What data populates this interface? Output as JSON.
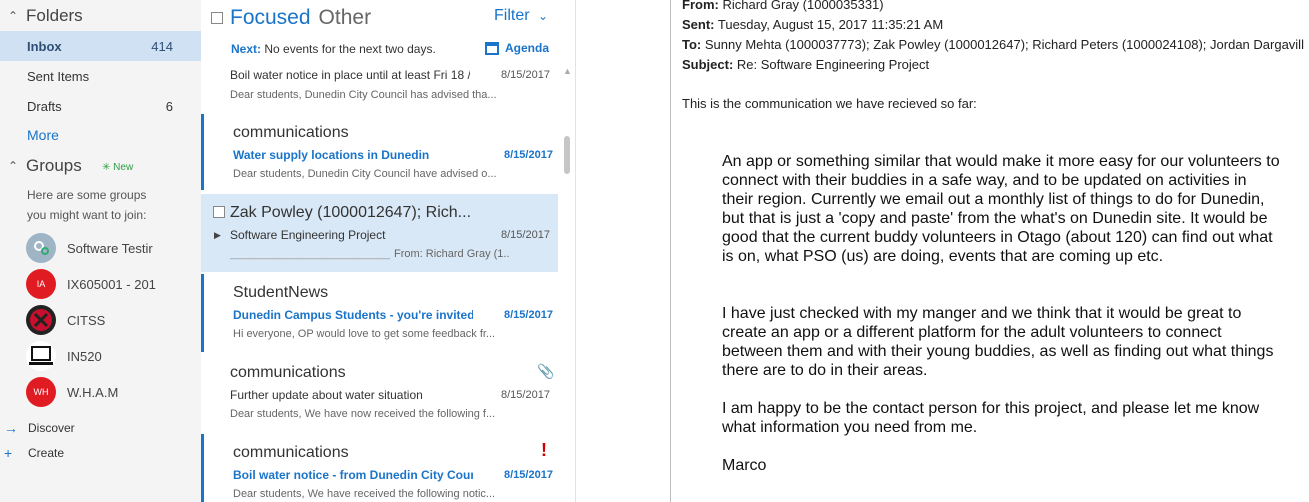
{
  "folders_pane": {
    "folders_title": "Folders",
    "items": [
      {
        "name": "Inbox",
        "count": "414"
      },
      {
        "name": "Sent Items",
        "count": ""
      },
      {
        "name": "Drafts",
        "count": "6"
      }
    ],
    "more_label": "More",
    "groups_title": "Groups",
    "new_badge": "New",
    "hint_line1": "Here are some groups",
    "hint_line2": "you might want to join:",
    "groups": [
      {
        "name": "Software Testir",
        "avatar_text": "",
        "color": "#9fb4c4"
      },
      {
        "name": "IX605001 - 201",
        "avatar_text": "IA",
        "color": "#e01b22"
      },
      {
        "name": "CITSS",
        "avatar_text": "",
        "color": "#c8102e"
      },
      {
        "name": "IN520",
        "avatar_text": "",
        "color": "#ffffff"
      },
      {
        "name": "W.H.A.M",
        "avatar_text": "WH",
        "color": "#e01b22"
      }
    ],
    "discover_label": "Discover",
    "create_label": "Create"
  },
  "message_list": {
    "tab_focused": "Focused",
    "tab_other": "Other",
    "filter_label": "Filter",
    "next_label": "Next:",
    "next_text": "No events for the next two days.",
    "agenda_label": "Agenda",
    "messages": [
      {
        "sender": "",
        "subject": "Boil water notice in place until at least Fri 18 /",
        "date": "8/15/2017",
        "preview": "Dear students,   Dunedin City Council has advised tha..."
      },
      {
        "sender": "communications",
        "subject": "Water supply locations in Dunedin",
        "date": "8/15/2017",
        "preview": "Dear students,   Dunedin City Council have advised o..."
      },
      {
        "sender": "Zak Powley (1000012647); Rich...",
        "subject": "Software Engineering Project",
        "date": "8/15/2017",
        "preview": "_________________________________  From: Richard Gray (1...",
        "preview_left": "_______________________________",
        "preview_right": "From: Richard Gray (1..."
      },
      {
        "sender": "StudentNews",
        "subject": "Dunedin Campus Students - you're invited t",
        "date": "8/15/2017",
        "preview": "Hi everyone,  OP would love to get some feedback fr..."
      },
      {
        "sender": "communications",
        "subject": "Further update about water situation",
        "date": "8/15/2017",
        "preview": "Dear students,   We have now received the following f..."
      },
      {
        "sender": "communications",
        "subject": "Boil water notice - from Dunedin City Counc",
        "date": "8/15/2017",
        "preview": "Dear students,   We have received the following notic..."
      }
    ]
  },
  "reading_pane": {
    "from_label": "From:",
    "from_value": "Richard Gray (1000035331)",
    "sent_label": "Sent:",
    "sent_value": "Tuesday, August 15, 2017 11:35:21 AM",
    "to_label": "To:",
    "to_value": "Sunny Mehta (1000037773); Zak Powley (1000012647); Richard Peters (1000024108); Jordan Dargavill",
    "subject_label": "Subject:",
    "subject_value": "Re: Software Engineering Project",
    "intro": "This is the communication we have recieved so far:",
    "paragraphs": [
      "An app or something similar that would make it more easy for our volunteers to connect with their buddies in a safe way, and to be updated on activities in their region. Currently we email out a monthly list of things to do for Dunedin, but that is just a 'copy and paste' from the what's on Dunedin site. It would be good that the current buddy volunteers in Otago (about 120) can find out what is on, what PSO (us) are doing, events that are coming up etc.",
      "I have just checked with my manger and we think that it would be great to create an app or a different platform for the adult volunteers to connect between them and with their young buddies, as well as finding out what things there are to do in their areas.",
      "I am happy to be the contact person for this project, and please let me know what information you need from me.",
      "Marco"
    ]
  }
}
